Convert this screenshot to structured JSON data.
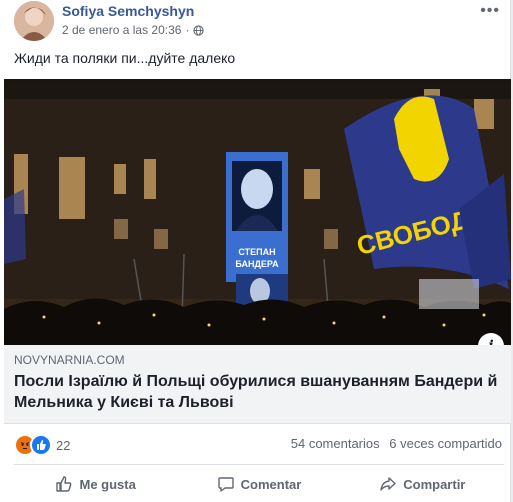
{
  "post": {
    "author": "Sofiya Semchyshyn",
    "timestamp": "2 de enero a las 20:36",
    "separator": "·",
    "privacy_icon": "globe-icon",
    "more_icon": "more-icon",
    "more_label": "•••",
    "text": "Жиди та поляки пи...дуйте далеко"
  },
  "link": {
    "domain": "NOVYNARNIA.COM",
    "headline": "Посли Ізраїлю й Польщі обурилися вшануванням Бандери й Мельника у Києві та Львові",
    "info_label": "i",
    "image": {
      "banner_text_1": "СТЕПАН",
      "banner_text_2": "БАНДЕРА",
      "flag_text": "СВОБОДА"
    }
  },
  "engagement": {
    "reaction_count": "22",
    "comments": "54 comentarios",
    "shares": "6 veces compartido"
  },
  "actions": [
    {
      "label": "Me gusta",
      "icon": "thumbs-up-icon"
    },
    {
      "label": "Comentar",
      "icon": "comment-icon"
    },
    {
      "label": "Compartir",
      "icon": "share-icon"
    }
  ],
  "colors": {
    "author": "#385898",
    "flag_blue": "#2d3a8c",
    "flag_yellow": "#f2d500"
  }
}
